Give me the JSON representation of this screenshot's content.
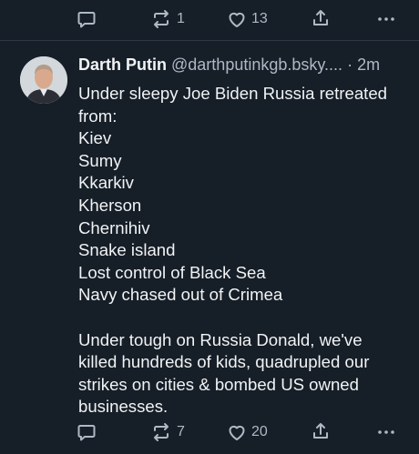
{
  "prev_post": {
    "actions": {
      "reposts": "1",
      "likes": "13"
    }
  },
  "post": {
    "author_name": "Darth Putin",
    "handle": "@darthputinkgb.bsky....",
    "time": "· 2m",
    "lines": [
      "Under sleepy Joe Biden Russia retreated",
      "from:",
      "Kiev",
      "Sumy",
      "Kkarkiv",
      "Kherson",
      "Chernihiv",
      "Snake island",
      "Lost control of Black Sea",
      "Navy chased out of Crimea"
    ],
    "para2": [
      "Under tough on Russia Donald, we've",
      "killed hundreds of kids, quadrupled our",
      "strikes on cities & bombed US owned",
      "businesses."
    ],
    "actions": {
      "reposts": "7",
      "likes": "20"
    }
  },
  "icons": {
    "reply": "reply-icon",
    "repost": "repost-icon",
    "like": "heart-icon",
    "share": "share-icon",
    "more": "more-icon"
  }
}
